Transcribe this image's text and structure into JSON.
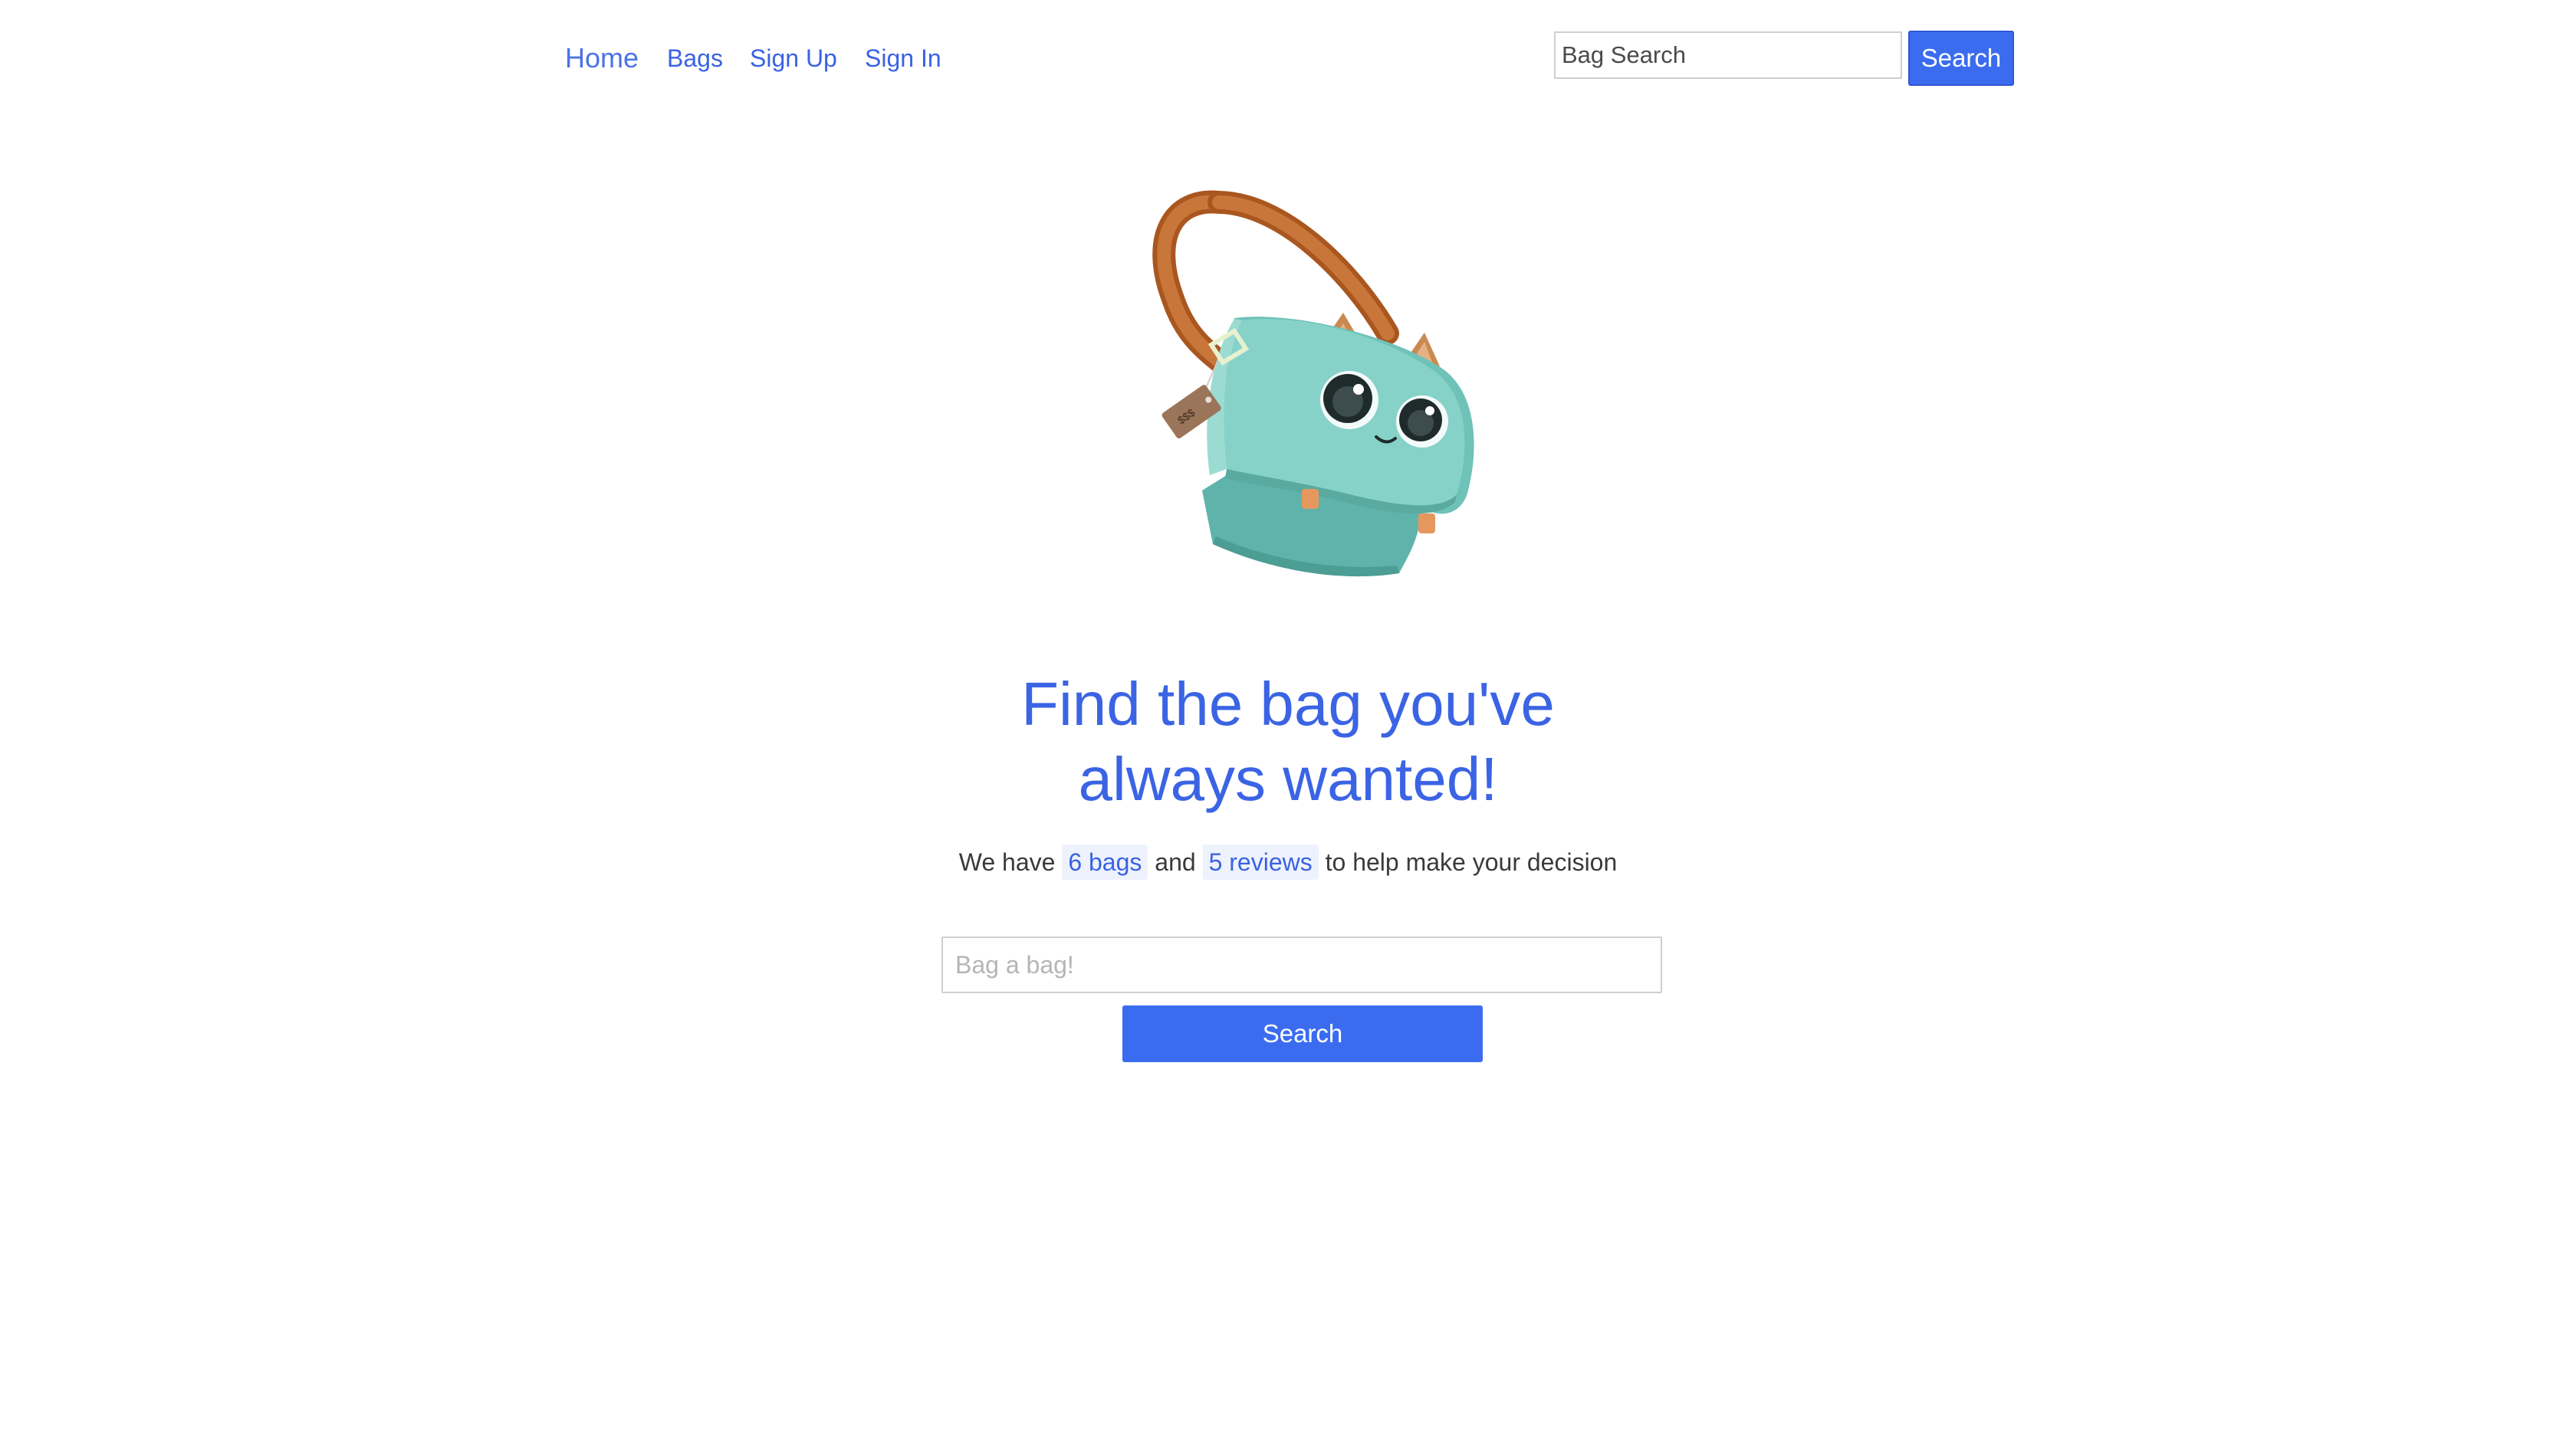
{
  "nav": {
    "links": [
      {
        "label": "Home"
      },
      {
        "label": "Bags"
      },
      {
        "label": "Sign Up"
      },
      {
        "label": "Sign In"
      }
    ],
    "search_placeholder": "Bag Search",
    "search_button": "Search"
  },
  "hero": {
    "illustration": "bag-mascot-illustration",
    "headline_line1": "Find the bag you've",
    "headline_line2": "always wanted!",
    "stats": {
      "prefix": "We have",
      "bags_count": "6 bags",
      "connector": "and",
      "reviews_count": "5 reviews",
      "suffix": "to help make your decision"
    },
    "search_placeholder": "Bag a bag!",
    "search_button": "Search"
  },
  "colors": {
    "brand_blue": "#3b6cf0",
    "link_blue": "#3a62e3",
    "bag_teal": "#7fcdc4",
    "strap_brown": "#c0672e"
  }
}
